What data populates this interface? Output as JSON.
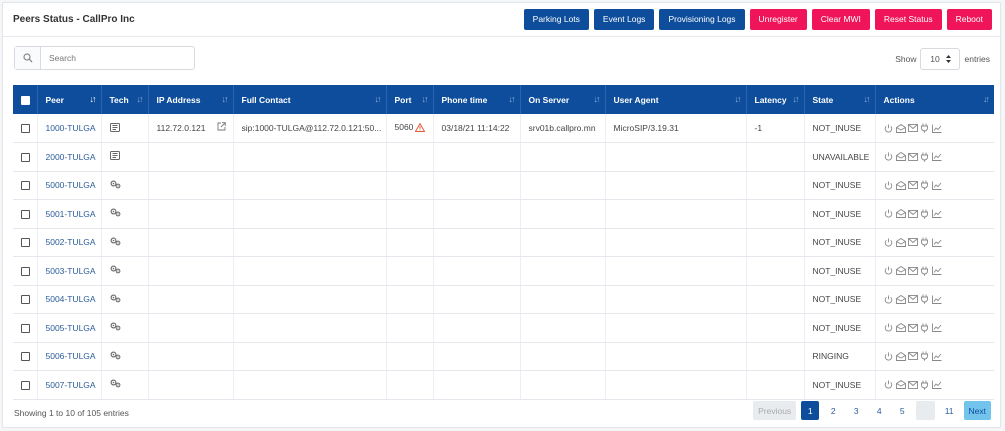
{
  "header": {
    "title": "Peers Status - CallPro Inc",
    "buttons": [
      {
        "label": "Parking Lots",
        "color": "#0d4d9c"
      },
      {
        "label": "Event Logs",
        "color": "#0d4d9c"
      },
      {
        "label": "Provisioning Logs",
        "color": "#0d4d9c"
      },
      {
        "label": "Unregister",
        "color": "#f0145a"
      },
      {
        "label": "Clear MWI",
        "color": "#f0145a"
      },
      {
        "label": "Reset Status",
        "color": "#f0145a"
      },
      {
        "label": "Reboot",
        "color": "#f0145a"
      }
    ]
  },
  "search": {
    "placeholder": "Search",
    "value": "",
    "icon": "search-icon"
  },
  "length": {
    "show_label": "Show",
    "value": "10",
    "entries_label": "entries"
  },
  "table": {
    "columns": [
      "Peer",
      "Tech",
      "IP Address",
      "Full Contact",
      "Port",
      "Phone time",
      "On Server",
      "User Agent",
      "Latency",
      "State",
      "Actions"
    ],
    "rows": [
      {
        "peer": "1000-TULGA",
        "tech": "sip-phone-icon",
        "ip": "112.72.0.121",
        "contact": "sip:1000-TULGA@112.72.0.121:50...",
        "port": "5060",
        "port_warning": true,
        "phone_time": "03/18/21 11:14:22",
        "server": "srv01b.callpro.mn",
        "agent": "MicroSIP/3.19.31",
        "latency": "-1",
        "state": "NOT_INUSE"
      },
      {
        "peer": "2000-TULGA",
        "tech": "sip-phone-icon",
        "ip": "",
        "contact": "",
        "port": "",
        "port_warning": false,
        "phone_time": "",
        "server": "",
        "agent": "",
        "latency": "",
        "state": "UNAVAILABLE"
      },
      {
        "peer": "5000-TULGA",
        "tech": "gears-icon",
        "ip": "",
        "contact": "",
        "port": "",
        "port_warning": false,
        "phone_time": "",
        "server": "",
        "agent": "",
        "latency": "",
        "state": "NOT_INUSE"
      },
      {
        "peer": "5001-TULGA",
        "tech": "gears-icon",
        "ip": "",
        "contact": "",
        "port": "",
        "port_warning": false,
        "phone_time": "",
        "server": "",
        "agent": "",
        "latency": "",
        "state": "NOT_INUSE"
      },
      {
        "peer": "5002-TULGA",
        "tech": "gears-icon",
        "ip": "",
        "contact": "",
        "port": "",
        "port_warning": false,
        "phone_time": "",
        "server": "",
        "agent": "",
        "latency": "",
        "state": "NOT_INUSE"
      },
      {
        "peer": "5003-TULGA",
        "tech": "gears-icon",
        "ip": "",
        "contact": "",
        "port": "",
        "port_warning": false,
        "phone_time": "",
        "server": "",
        "agent": "",
        "latency": "",
        "state": "NOT_INUSE"
      },
      {
        "peer": "5004-TULGA",
        "tech": "gears-icon",
        "ip": "",
        "contact": "",
        "port": "",
        "port_warning": false,
        "phone_time": "",
        "server": "",
        "agent": "",
        "latency": "",
        "state": "NOT_INUSE"
      },
      {
        "peer": "5005-TULGA",
        "tech": "gears-icon",
        "ip": "",
        "contact": "",
        "port": "",
        "port_warning": false,
        "phone_time": "",
        "server": "",
        "agent": "",
        "latency": "",
        "state": "NOT_INUSE"
      },
      {
        "peer": "5006-TULGA",
        "tech": "gears-icon",
        "ip": "",
        "contact": "",
        "port": "",
        "port_warning": false,
        "phone_time": "",
        "server": "",
        "agent": "",
        "latency": "",
        "state": "RINGING"
      },
      {
        "peer": "5007-TULGA",
        "tech": "gears-icon",
        "ip": "",
        "contact": "",
        "port": "",
        "port_warning": false,
        "phone_time": "",
        "server": "",
        "agent": "",
        "latency": "",
        "state": "NOT_INUSE"
      }
    ],
    "row_actions": [
      "power-icon",
      "envelope-open-icon",
      "envelope-icon",
      "plug-icon",
      "chart-icon"
    ]
  },
  "footer": {
    "info": "Showing 1 to 10 of 105 entries",
    "pagination": {
      "previous": "Previous",
      "pages": [
        "1",
        "2",
        "3",
        "4",
        "5",
        "…",
        "11"
      ],
      "active": "1",
      "next": "Next"
    }
  }
}
